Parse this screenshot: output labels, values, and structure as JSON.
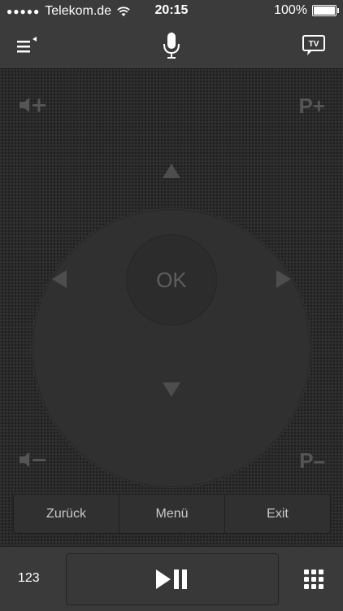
{
  "status_bar": {
    "carrier": "Telekom.de",
    "time": "20:15",
    "battery": "100%"
  },
  "nav": {
    "menu_icon": "menu-list-icon",
    "mic_icon": "microphone-icon",
    "tv_icon_label": "TV"
  },
  "remote": {
    "vol_up_icon": "volume-up-icon",
    "vol_down_icon": "volume-down-icon",
    "program_up": "P+",
    "program_down": "P–",
    "ok_label": "OK"
  },
  "function_buttons": [
    "Zurück",
    "Menü",
    "Exit"
  ],
  "toolbar": {
    "numpad_label": "123",
    "play_icon": "play-pause-icon",
    "keypad_icon": "keypad-grid-icon"
  },
  "colors": {
    "background": "#2b2b2b",
    "bar": "#3b3b3b",
    "dim_text": "#555555"
  }
}
